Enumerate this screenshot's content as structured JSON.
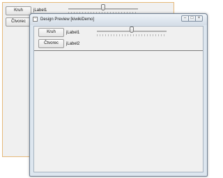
{
  "designer_form": {
    "button1_label": "Kruh",
    "label1": "jLabel1",
    "button2_label": "Čtvorec",
    "slider_value": 0.5
  },
  "preview_window": {
    "title": "Design Preview [kiwikiDemo]",
    "title_buttons": {
      "minimize": "–",
      "maximize": "□",
      "close": "×"
    },
    "button1_label": "Kruh",
    "label1": "jLabel1",
    "button2_label": "Čtvorec",
    "label2": "jLabel2",
    "slider_value": 0.5
  }
}
